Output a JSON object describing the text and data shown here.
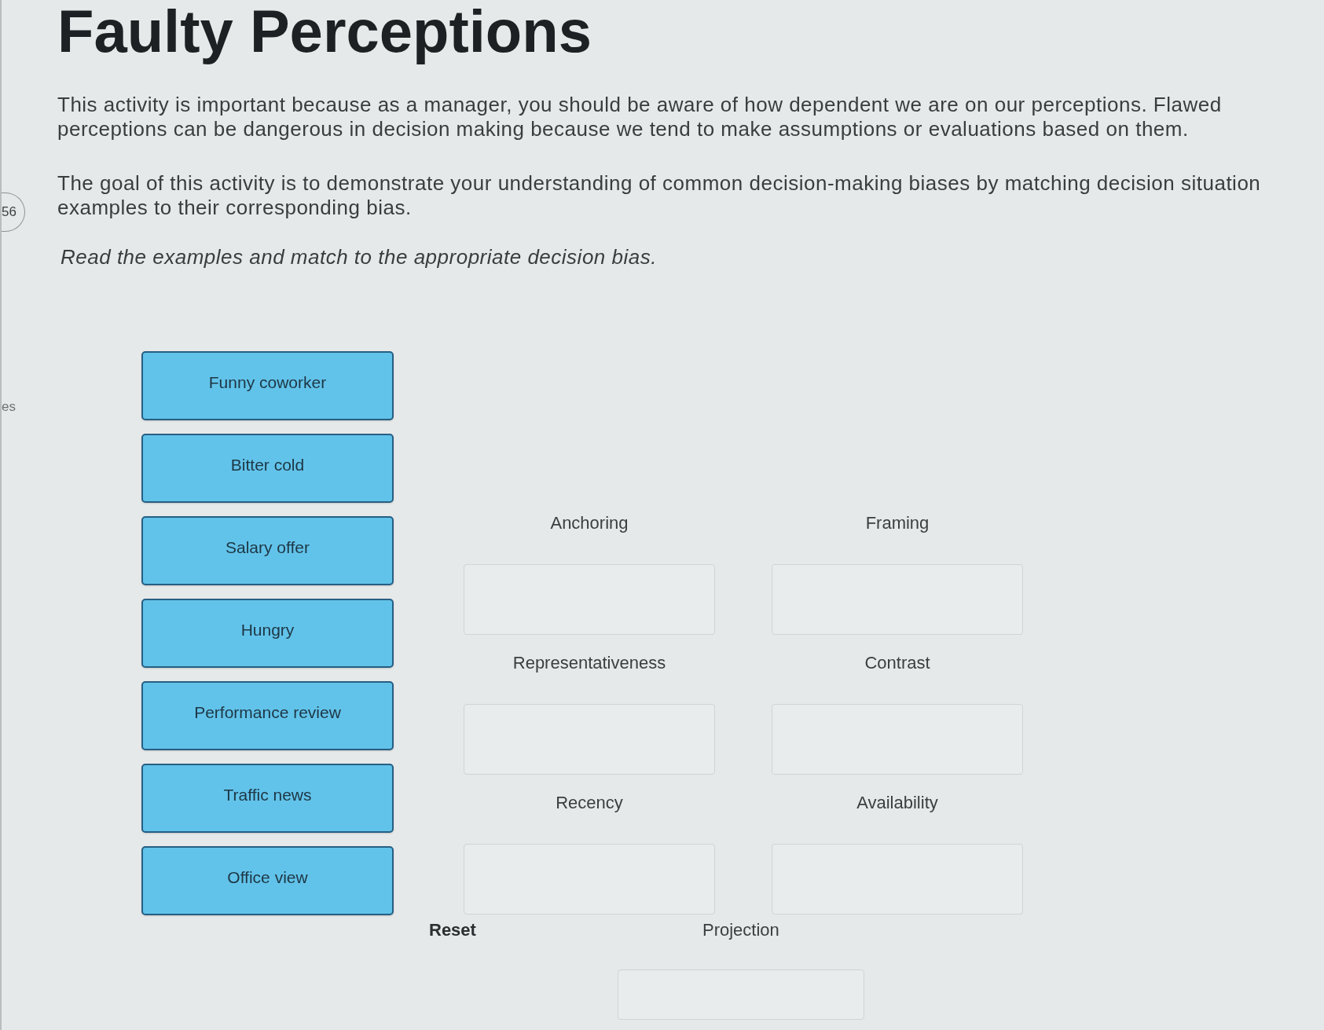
{
  "sidebar": {
    "badge": "56",
    "text": "es"
  },
  "page": {
    "title": "Faulty Perceptions",
    "paragraphs": [
      "This activity is important because as a manager, you should be aware of how dependent we are on our perceptions. Flawed perceptions can be dangerous in decision making because we tend to make assumptions or evaluations based on them.",
      "The goal of this activity is to demonstrate your understanding of common decision-making biases by matching decision situation examples to their corresponding bias."
    ],
    "instruction": "Read the examples and match to the appropriate decision bias."
  },
  "examples": [
    {
      "label": "Funny coworker"
    },
    {
      "label": "Bitter cold"
    },
    {
      "label": "Salary offer"
    },
    {
      "label": "Hungry"
    },
    {
      "label": "Performance review"
    },
    {
      "label": "Traffic news"
    },
    {
      "label": "Office view"
    }
  ],
  "biases": [
    {
      "label": "Anchoring"
    },
    {
      "label": "Framing"
    },
    {
      "label": "Representativeness"
    },
    {
      "label": "Contrast"
    },
    {
      "label": "Recency"
    },
    {
      "label": "Availability"
    },
    {
      "label": "Projection"
    }
  ],
  "reset_button": {
    "label": "Reset"
  }
}
